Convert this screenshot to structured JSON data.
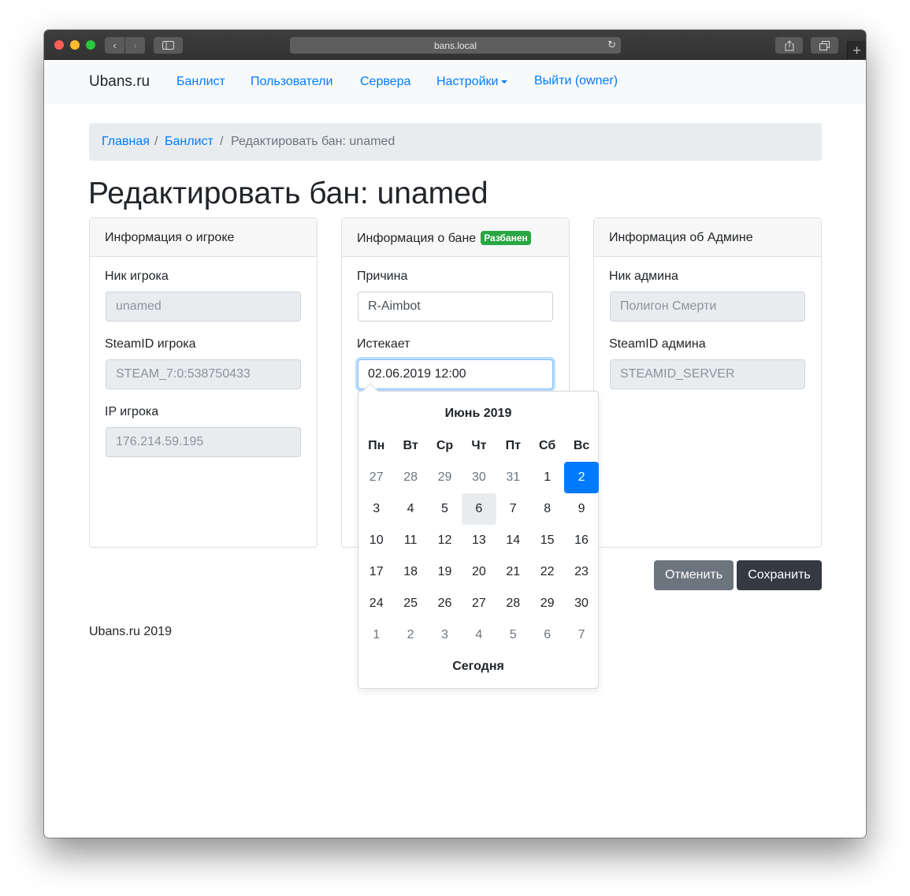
{
  "browser": {
    "url": "bans.local"
  },
  "navbar": {
    "brand": "Ubans.ru",
    "links": [
      "Банлист",
      "Пользователи",
      "Сервера",
      "Настройки",
      "Выйти (owner)"
    ]
  },
  "breadcrumb": {
    "home": "Главная",
    "sep1": "/",
    "banlist": "Банлист",
    "sep2": "/",
    "current": "Редактировать бан: unamed"
  },
  "page_title": "Редактировать бан: unamed",
  "player_card": {
    "title": "Информация о игроке",
    "nick_label": "Ник игрока",
    "nick_value": "unamed",
    "steamid_label": "SteamID игрока",
    "steamid_value": "STEAM_7:0:538750433",
    "ip_label": "IP игрока",
    "ip_value": "176.214.59.195"
  },
  "ban_card": {
    "title": "Информация о бане",
    "badge": "Разбанен",
    "reason_label": "Причина",
    "reason_value": "R-Aimbot",
    "expires_label": "Истекает",
    "expires_value": "02.06.2019 12:00"
  },
  "admin_card": {
    "title": "Информация об Админе",
    "nick_label": "Ник админа",
    "nick_value": "Полигон Смерти",
    "steamid_label": "SteamID админа",
    "steamid_value": "STEAMID_SERVER"
  },
  "buttons": {
    "cancel": "Отменить",
    "save": "Сохранить"
  },
  "footer": "Ubans.ru 2019",
  "datepicker": {
    "month": "Июнь 2019",
    "weekdays": [
      "Пн",
      "Вт",
      "Ср",
      "Чт",
      "Пт",
      "Сб",
      "Вс"
    ],
    "weeks": [
      [
        "27",
        "28",
        "29",
        "30",
        "31",
        "1",
        "2"
      ],
      [
        "3",
        "4",
        "5",
        "6",
        "7",
        "8",
        "9"
      ],
      [
        "10",
        "11",
        "12",
        "13",
        "14",
        "15",
        "16"
      ],
      [
        "17",
        "18",
        "19",
        "20",
        "21",
        "22",
        "23"
      ],
      [
        "24",
        "25",
        "26",
        "27",
        "28",
        "29",
        "30"
      ],
      [
        "1",
        "2",
        "3",
        "4",
        "5",
        "6",
        "7"
      ]
    ],
    "selected_day": "2",
    "today_day": "6",
    "today_label": "Сегодня"
  },
  "colors": {
    "primary": "#007bff",
    "success": "#28a745",
    "secondary": "#6c757d",
    "dark": "#343a40"
  }
}
